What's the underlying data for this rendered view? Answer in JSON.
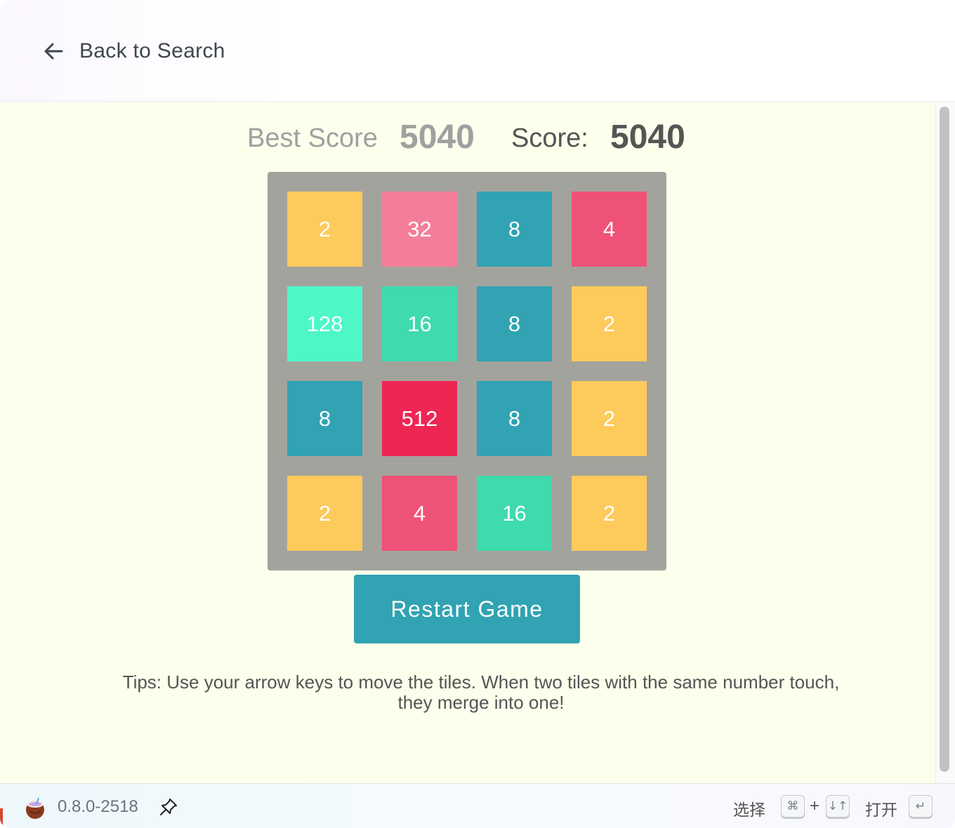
{
  "header": {
    "back_label": "Back to Search"
  },
  "scores": {
    "best_label": "Best Score",
    "best_value": "5040",
    "score_label": "Score:",
    "score_value": "5040"
  },
  "board": {
    "rows": [
      [
        "2",
        "32",
        "8",
        "4"
      ],
      [
        "128",
        "16",
        "8",
        "2"
      ],
      [
        "8",
        "512",
        "8",
        "2"
      ],
      [
        "2",
        "4",
        "16",
        "2"
      ]
    ],
    "tile_colors": {
      "2": "#fdca5c",
      "4": "#ef5277",
      "8": "#31a3b3",
      "16": "#3fdaae",
      "32": "#f47e9a",
      "128": "#4ef7c8",
      "512": "#ed2654"
    }
  },
  "restart_label": "Restart Game",
  "tips": "Tips: Use your arrow keys to move the tiles. When two tiles with the same number touch, they merge into one!",
  "footer": {
    "version": "0.8.0-2518",
    "select_label": "选择",
    "select_key": "⌘",
    "plus": "+",
    "arrows_key": "↓↑",
    "open_label": "打开",
    "enter_key": "↵"
  }
}
